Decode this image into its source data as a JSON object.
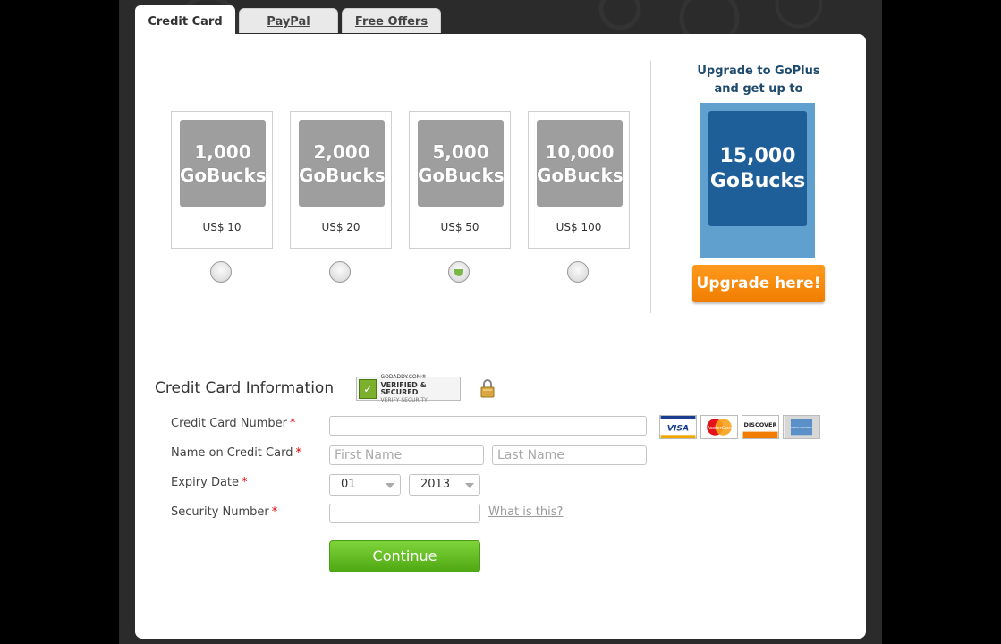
{
  "tabs": [
    {
      "label": "Credit Card",
      "active": true
    },
    {
      "label": "PayPal",
      "active": false
    },
    {
      "label": "Free Offers",
      "active": false
    }
  ],
  "packages": [
    {
      "amount": "1,000",
      "unit": "GoBucks",
      "price": "US$ 10",
      "selected": false
    },
    {
      "amount": "2,000",
      "unit": "GoBucks",
      "price": "US$ 20",
      "selected": false
    },
    {
      "amount": "5,000",
      "unit": "GoBucks",
      "price": "US$ 50",
      "selected": true
    },
    {
      "amount": "10,000",
      "unit": "GoBucks",
      "price": "US$ 100",
      "selected": false
    }
  ],
  "upsell": {
    "line1": "Upgrade to GoPlus",
    "line2": "and get up to",
    "amount": "15,000",
    "unit": "GoBucks",
    "button_label": "Upgrade here!",
    "card_color": "#1f5f99",
    "frame_color": "#5fa0cf",
    "button_color": "#f07d00"
  },
  "form": {
    "title": "Credit Card Information",
    "seal": {
      "line1": "GODADDY.COM®",
      "line2": "VERIFIED & SECURED",
      "line3": "VERIFY SECURITY",
      "icon": "shield-check-icon"
    },
    "lock_icon": "padlock-icon",
    "card_number_label": "Credit Card Number",
    "name_label": "Name on Credit Card",
    "expiry_label": "Expiry Date",
    "security_label": "Security Number",
    "required_mark": "*",
    "card_number_value": "",
    "first_name_placeholder": "First Name",
    "last_name_placeholder": "Last Name",
    "expiry_month": "01",
    "expiry_year": "2013",
    "security_value": "",
    "what_is_this": "What is this?",
    "continue_label": "Continue",
    "continue_color": "#4fa813",
    "required_color": "#dd0000"
  },
  "card_logos": [
    {
      "name": "VISA"
    },
    {
      "name": "MasterCard"
    },
    {
      "name": "DISCOVER"
    },
    {
      "name": "AMERICAN EXPRESS"
    }
  ]
}
